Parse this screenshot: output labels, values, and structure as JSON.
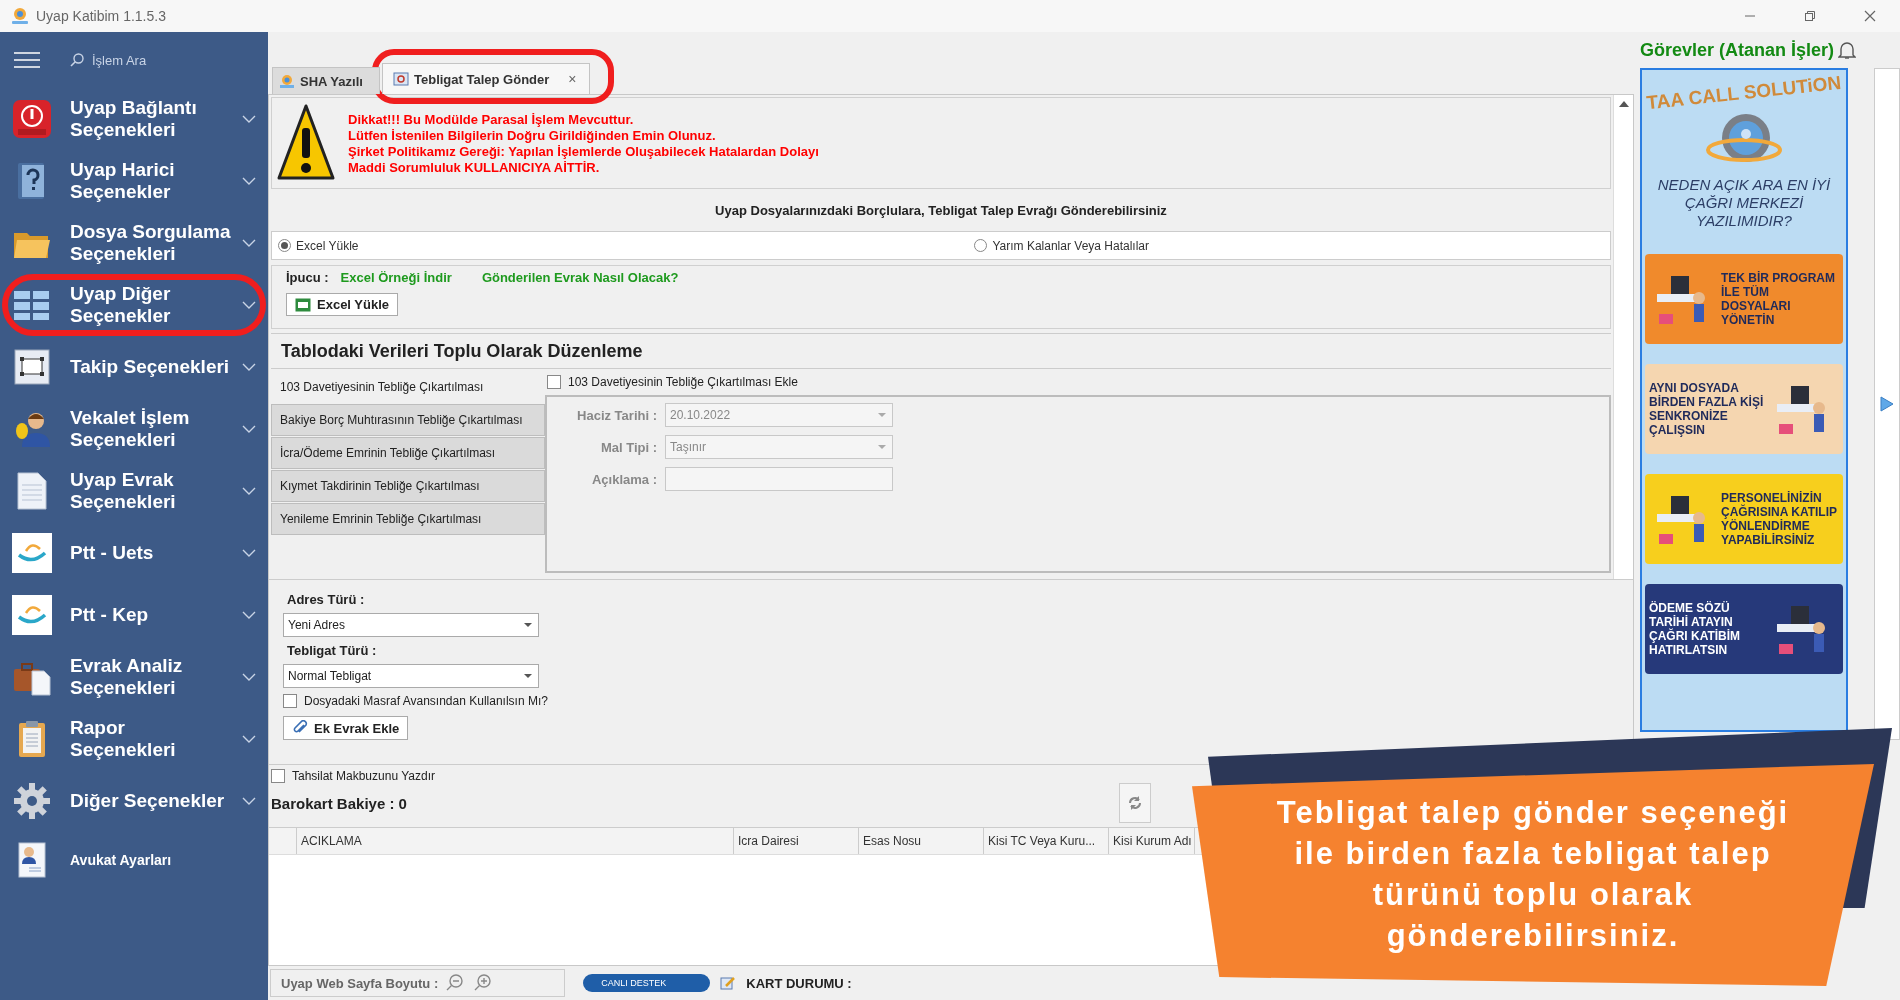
{
  "window": {
    "title": "Uyap Katibim 1.1.5.3"
  },
  "sidebar": {
    "search_placeholder": "İşlem Ara",
    "items": [
      {
        "label": "Uyap Bağlantı Seçenekleri",
        "kind": "group",
        "highlighted": false
      },
      {
        "label": "Uyap Harici Seçenekler",
        "kind": "group",
        "highlighted": false
      },
      {
        "label": "Dosya Sorgulama Seçenekleri",
        "kind": "group",
        "highlighted": false
      },
      {
        "label": "Uyap Diğer Seçenekler",
        "kind": "group",
        "highlighted": true
      },
      {
        "label": "Takip Seçenekleri",
        "kind": "group",
        "highlighted": false
      },
      {
        "label": "Vekalet İşlem Seçenekleri",
        "kind": "group",
        "highlighted": false
      },
      {
        "label": "Uyap Evrak Seçenekleri",
        "kind": "group",
        "highlighted": false
      },
      {
        "label": "Ptt - Uets",
        "kind": "group",
        "highlighted": false
      },
      {
        "label": "Ptt - Kep",
        "kind": "group",
        "highlighted": false
      },
      {
        "label": "Evrak Analiz Seçenekleri",
        "kind": "group",
        "highlighted": false
      },
      {
        "label": "Rapor Seçenekleri",
        "kind": "group",
        "highlighted": false
      },
      {
        "label": "Diğer Seçenekler",
        "kind": "group",
        "highlighted": false
      },
      {
        "label": "Avukat Ayarları",
        "kind": "link",
        "highlighted": false
      }
    ]
  },
  "tabs": [
    {
      "label": "SHA Yazılı",
      "selected": false,
      "highlighted": false
    },
    {
      "label": "Tebligat Talep Gönder",
      "selected": true,
      "highlighted": true,
      "close": "×"
    }
  ],
  "warning": {
    "lines": [
      "Dikkat!!! Bu Modülde Parasal İşlem Mevcuttur.",
      "Lütfen İstenilen Bilgilerin Doğru Girildiğinden Emin Olunuz.",
      "Şirket Politikamız Gereği: Yapılan İşlemlerde Oluşabilecek Hatalardan Dolayı",
      "Maddi Sorumluluk KULLANICIYA AİTTİR."
    ]
  },
  "heading": "Uyap Dosyalarınızdaki Borçlulara, Tebligat Talep Evrağı Gönderebilirsiniz",
  "modes": [
    {
      "label": "Excel Yükle",
      "selected": true
    },
    {
      "label": "Yarım Kalanlar Veya Hatalılar",
      "selected": false
    }
  ],
  "hint": {
    "label": "İpucu :",
    "links": [
      "Excel Örneği İndir",
      "Gönderilen Evrak Nasıl Olacak?"
    ],
    "button": "Excel Yükle"
  },
  "bulk_edit": {
    "title": "Tablodaki Verileri Toplu Olarak Düzenleme",
    "tabs": [
      {
        "label": "103 Davetiyesinin Tebliğe Çıkartılması",
        "selected": true
      },
      {
        "label": "Bakiye Borç Muhtırasının Tebliğe Çıkartılması",
        "selected": false
      },
      {
        "label": "İcra/Ödeme Emrinin Tebliğe Çıkartılması",
        "selected": false
      },
      {
        "label": "Kıymet Takdirinin Tebliğe Çıkartılması",
        "selected": false
      },
      {
        "label": "Yenileme Emrinin Tebliğe Çıkartılması",
        "selected": false
      }
    ],
    "add_checkbox": {
      "label": "103 Davetiyesinin Tebliğe Çıkartılması Ekle",
      "checked": false
    },
    "fields": [
      {
        "label": "Haciz Tarihi :",
        "value": "20.10.2022",
        "kind": "dropdown",
        "disabled": true
      },
      {
        "label": "Mal Tipi :",
        "value": "Taşınır",
        "kind": "dropdown",
        "disabled": true
      },
      {
        "label": "Açıklama :",
        "kind": "text",
        "disabled": true
      }
    ]
  },
  "address": {
    "fields": [
      {
        "label": "Adres Türü :",
        "value": "Yeni Adres"
      },
      {
        "label": "Tebligat Türü :",
        "value": "Normal Tebligat"
      }
    ],
    "expense_checkbox": {
      "label": "Dosyadaki Masraf Avansından Kullanılsın Mı?",
      "checked": false
    },
    "button": "Ek Evrak Ekle"
  },
  "receipt_checkbox": {
    "label": "Tahsilat Makbuzunu Yazdır",
    "checked": false
  },
  "balance": "Barokart Bakiye : 0",
  "table": {
    "columns": [
      "ACIKLAMA",
      "Icra Dairesi",
      "Esas Nosu",
      "Kisi TC Veya Kuru...",
      "Kisi Kurum Adı"
    ]
  },
  "status_bar": {
    "zoom_label": "Uyap Web Sayfa Boyutu :",
    "support": "CANLI DESTEK",
    "card_status": "KART DURUMU :"
  },
  "tasks": {
    "title": "Görevler (Atanan İşler)"
  },
  "ad": {
    "brand": "TAA CALL SOLUTiON",
    "question": "NEDEN AÇIK ARA EN İYİ ÇAĞRI MERKEZİ YAZILIMIDIR?",
    "cards": [
      {
        "text": "TEK BİR PROGRAM İLE TÜM DOSYALARI YÖNETİN",
        "color": "#f08a2c"
      },
      {
        "text": "AYNI DOSYADA BİRDEN FAZLA KİŞİ SENKRONİZE ÇALIŞSIN",
        "color": "#f5d6b0"
      },
      {
        "text": "PERSONELİNİZİN ÇAĞRISINA KATILIP YÖNLENDİRME YAPABİLİRSİNİZ",
        "color": "#f7cf1d"
      },
      {
        "text": "ÖDEME SÖZÜ TARİHİ ATAYIN ÇAĞRI KATİBİM HATIRLATSIN",
        "color": "#26397a"
      }
    ]
  },
  "callout": {
    "text": "Tebligat talep gönder seçeneği\nile birden fazla tebligat talep\ntürünü toplu olarak\ngönderebilirsiniz."
  }
}
